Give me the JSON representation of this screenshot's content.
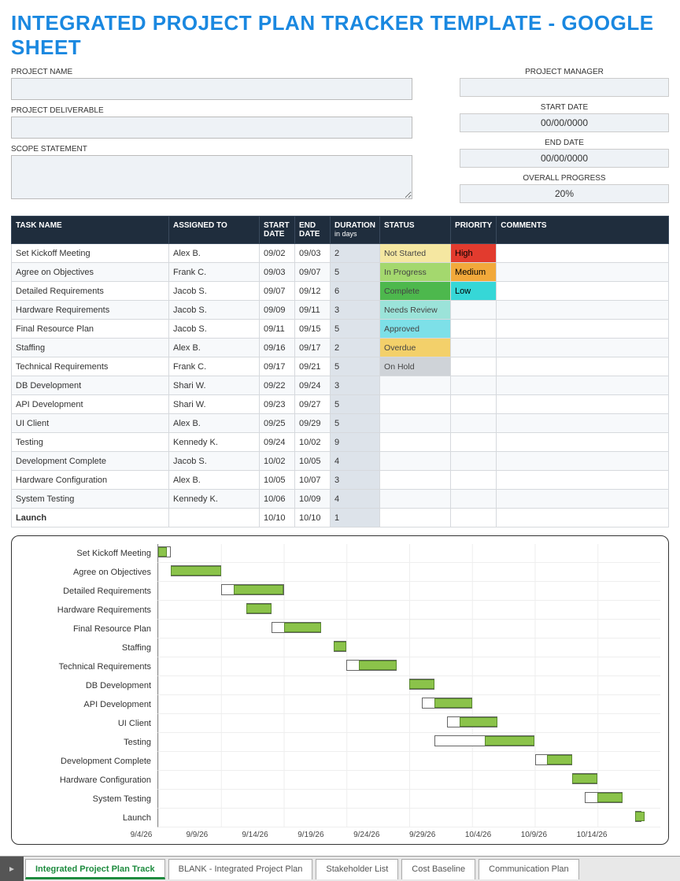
{
  "title": "INTEGRATED PROJECT PLAN TRACKER TEMPLATE - GOOGLE SHEET",
  "fields": {
    "project_name_label": "PROJECT NAME",
    "project_name": "",
    "project_deliverable_label": "PROJECT DELIVERABLE",
    "project_deliverable": "",
    "scope_label": "SCOPE STATEMENT",
    "scope": "",
    "pm_label": "PROJECT MANAGER",
    "pm": "",
    "start_label": "START DATE",
    "start": "00/00/0000",
    "end_label": "END DATE",
    "end": "00/00/0000",
    "progress_label": "OVERALL PROGRESS",
    "progress": "20%"
  },
  "columns": {
    "task": "TASK NAME",
    "assigned": "ASSIGNED TO",
    "sd": "START DATE",
    "ed": "END DATE",
    "dur": "DURATION",
    "dur_sub": "in days",
    "status": "STATUS",
    "pri": "PRIORITY",
    "com": "COMMENTS"
  },
  "status_colors": {
    "Not Started": "#f5e7a1",
    "In Progress": "#a4d86e",
    "Complete": "#4db84d",
    "Needs Review": "#9be3d9",
    "Approved": "#7de0e8",
    "Overdue": "#f3d06a",
    "On Hold": "#cfd3d8"
  },
  "priority_colors": {
    "High": "#e23b2e",
    "Medium": "#f2a93b",
    "Low": "#36d7d7"
  },
  "tasks": [
    {
      "name": "Set Kickoff Meeting",
      "assigned": "Alex B.",
      "sd": "09/02",
      "ed": "09/03",
      "dur": "2",
      "status": "Not Started",
      "pri": "High",
      "com": ""
    },
    {
      "name": "Agree on Objectives",
      "assigned": "Frank C.",
      "sd": "09/03",
      "ed": "09/07",
      "dur": "5",
      "status": "In Progress",
      "pri": "Medium",
      "com": ""
    },
    {
      "name": "Detailed Requirements",
      "assigned": "Jacob S.",
      "sd": "09/07",
      "ed": "09/12",
      "dur": "6",
      "status": "Complete",
      "pri": "Low",
      "com": ""
    },
    {
      "name": "Hardware Requirements",
      "assigned": "Jacob S.",
      "sd": "09/09",
      "ed": "09/11",
      "dur": "3",
      "status": "Needs Review",
      "pri": "",
      "com": ""
    },
    {
      "name": "Final Resource Plan",
      "assigned": "Jacob S.",
      "sd": "09/11",
      "ed": "09/15",
      "dur": "5",
      "status": "Approved",
      "pri": "",
      "com": ""
    },
    {
      "name": "Staffing",
      "assigned": "Alex B.",
      "sd": "09/16",
      "ed": "09/17",
      "dur": "2",
      "status": "Overdue",
      "pri": "",
      "com": ""
    },
    {
      "name": "Technical Requirements",
      "assigned": "Frank C.",
      "sd": "09/17",
      "ed": "09/21",
      "dur": "5",
      "status": "On Hold",
      "pri": "",
      "com": ""
    },
    {
      "name": "DB Development",
      "assigned": "Shari W.",
      "sd": "09/22",
      "ed": "09/24",
      "dur": "3",
      "status": "",
      "pri": "",
      "com": ""
    },
    {
      "name": "API Development",
      "assigned": "Shari W.",
      "sd": "09/23",
      "ed": "09/27",
      "dur": "5",
      "status": "",
      "pri": "",
      "com": ""
    },
    {
      "name": "UI Client",
      "assigned": "Alex B.",
      "sd": "09/25",
      "ed": "09/29",
      "dur": "5",
      "status": "",
      "pri": "",
      "com": ""
    },
    {
      "name": "Testing",
      "assigned": "Kennedy K.",
      "sd": "09/24",
      "ed": "10/02",
      "dur": "9",
      "status": "",
      "pri": "",
      "com": ""
    },
    {
      "name": "Development Complete",
      "assigned": "Jacob S.",
      "sd": "10/02",
      "ed": "10/05",
      "dur": "4",
      "status": "",
      "pri": "",
      "com": ""
    },
    {
      "name": "Hardware Configuration",
      "assigned": "Alex B.",
      "sd": "10/05",
      "ed": "10/07",
      "dur": "3",
      "status": "",
      "pri": "",
      "com": ""
    },
    {
      "name": "System Testing",
      "assigned": "Kennedy K.",
      "sd": "10/06",
      "ed": "10/09",
      "dur": "4",
      "status": "",
      "pri": "",
      "com": ""
    },
    {
      "name": "Launch",
      "assigned": "",
      "sd": "10/10",
      "ed": "10/10",
      "dur": "1",
      "status": "",
      "pri": "",
      "com": "",
      "bold": true
    }
  ],
  "chart_data": {
    "type": "bar",
    "title": "",
    "x_axis": [
      "9/4/26",
      "9/9/26",
      "9/14/26",
      "9/19/26",
      "9/24/26",
      "9/29/26",
      "10/4/26",
      "10/9/26",
      "10/14/26"
    ],
    "x_min": 2,
    "x_max": 42,
    "series": [
      {
        "name": "Set Kickoff Meeting",
        "start": 2,
        "end": 3,
        "fill_start": 2,
        "fill_end": 2
      },
      {
        "name": "Agree on Objectives",
        "start": 3,
        "end": 7,
        "fill_start": 3,
        "fill_end": 7
      },
      {
        "name": "Detailed Requirements",
        "start": 7,
        "end": 12,
        "fill_start": 8,
        "fill_end": 12
      },
      {
        "name": "Hardware Requirements",
        "start": 9,
        "end": 11,
        "fill_start": 9,
        "fill_end": 11
      },
      {
        "name": "Final Resource Plan",
        "start": 11,
        "end": 15,
        "fill_start": 12,
        "fill_end": 15
      },
      {
        "name": "Staffing",
        "start": 16,
        "end": 17,
        "fill_start": 16,
        "fill_end": 17
      },
      {
        "name": "Technical Requirements",
        "start": 17,
        "end": 21,
        "fill_start": 18,
        "fill_end": 21
      },
      {
        "name": "DB Development",
        "start": 22,
        "end": 24,
        "fill_start": 22,
        "fill_end": 24
      },
      {
        "name": "API Development",
        "start": 23,
        "end": 27,
        "fill_start": 24,
        "fill_end": 27
      },
      {
        "name": "UI Client",
        "start": 25,
        "end": 29,
        "fill_start": 26,
        "fill_end": 29
      },
      {
        "name": "Testing",
        "start": 24,
        "end": 32,
        "fill_start": 28,
        "fill_end": 32
      },
      {
        "name": "Development Complete",
        "start": 32,
        "end": 35,
        "fill_start": 33,
        "fill_end": 35
      },
      {
        "name": "Hardware Configuration",
        "start": 35,
        "end": 37,
        "fill_start": 35,
        "fill_end": 37
      },
      {
        "name": "System Testing",
        "start": 36,
        "end": 39,
        "fill_start": 37,
        "fill_end": 39
      },
      {
        "name": "Launch",
        "start": 40,
        "end": 40,
        "fill_start": 40,
        "fill_end": 40
      }
    ]
  },
  "tabs": {
    "items": [
      "Integrated Project Plan Track",
      "BLANK - Integrated Project Plan",
      "Stakeholder List",
      "Cost Baseline",
      "Communication Plan"
    ],
    "active": 0
  }
}
